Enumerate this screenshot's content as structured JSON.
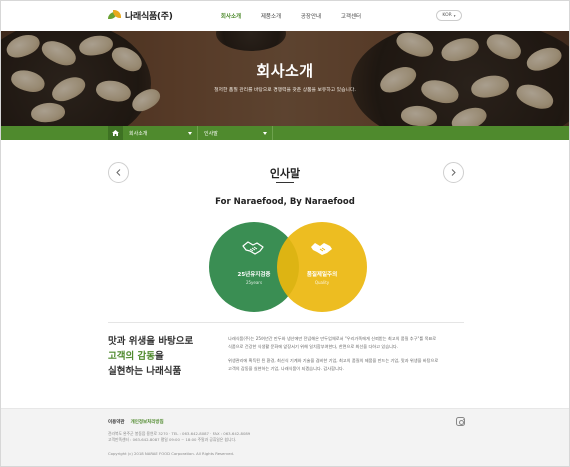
{
  "header": {
    "logo_text": "나래식품(주)",
    "nav": [
      {
        "label": "회사소개",
        "active": true
      },
      {
        "label": "제품소개",
        "active": false
      },
      {
        "label": "공장안내",
        "active": false
      },
      {
        "label": "고객센터",
        "active": false
      }
    ],
    "lang": "KOR"
  },
  "hero": {
    "title": "회사소개",
    "subtitle": "철저한 품질 관리를 바탕으로 경쟁력을 갖춘 상품을 보유하고 있습니다."
  },
  "breadcrumb": {
    "home_icon": "home-icon",
    "level1": "회사소개",
    "level2": "인사말"
  },
  "content": {
    "title": "인사말",
    "slogan": "For Naraefood, By Naraefood",
    "circles": [
      {
        "label": "25년유지검증",
        "sub": "25years",
        "icon": "handshake-icon",
        "color": "#2e8748"
      },
      {
        "label": "품질제일주의",
        "sub": "Quality",
        "icon": "handshake-icon",
        "color": "#ecb70e"
      }
    ],
    "headline": {
      "line1": "맛과 위생을 바탕으로",
      "line2_highlight": "고객의 감동",
      "line2_rest": "을",
      "line3": "실현하는 나래식품"
    },
    "paragraph1": [
      "나래식품(주)는 25여년간 만두와 냉산에만 전념해온 만두업체로서 \"우리가족에게 신뢰받는 최고의 품질 추구\"를 목표로",
      "식품으로 건강한 식생활 문화에 앞장서기 위해 일치함부여한다, 한면으로 최선을 다하고 있습니다."
    ],
    "paragraph2": [
      "위생관리에 획득된 된 환경, 최신식 기계와 기술을 겸비한 기업, 최고의 품질의 제품을 만드는 기업, 맛과 위생을 바탕으로",
      "고객의 감동을 실현하는 기업, 나래식품이 되겠습니다. 감사합니다."
    ]
  },
  "footer": {
    "links": [
      {
        "label": "이용약관",
        "green": false
      },
      {
        "label": "개인정보처리방침",
        "green": true
      }
    ],
    "info1": "전라북도 완주군 봉동읍 용연로 3270  ·  TEL : 063-642-8087  ·  FAX : 063-642-8089",
    "info2": "고객만족센터 : 063-642-8087 평일 09:00 ~ 18:00 주말과 공휴일은 쉽니다.",
    "copyright": "Copyright (c) 2018 NARAE FOOD Corporation. All Rights Reserved.",
    "social_icon": "instagram-icon"
  },
  "colors": {
    "brand_green": "#4f8a2d",
    "circle_green": "#2e8748",
    "circle_yellow": "#ecb70e"
  }
}
